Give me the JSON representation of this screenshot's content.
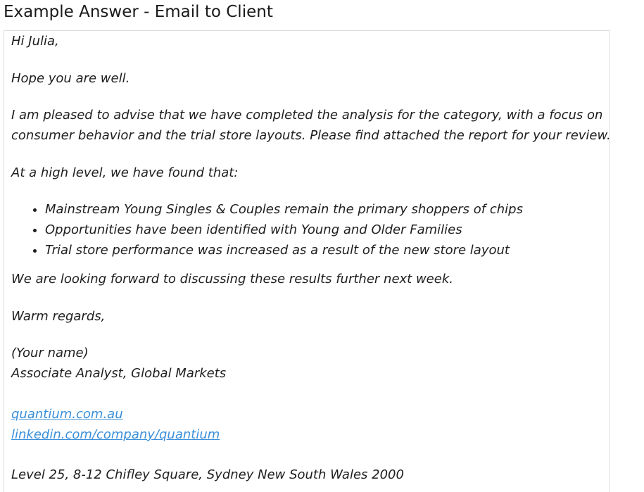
{
  "title": "Example Answer - Email to Client",
  "email": {
    "greeting": "Hi Julia,",
    "opener": "Hope you are well.",
    "body_line_1": "I am pleased to advise that we have completed the analysis for the category, with a focus on",
    "body_line_2": "consumer behavior and the trial store layouts. Please find attached the report for your review.",
    "findings_intro": "At a high level, we have found that:",
    "findings": [
      "Mainstream Young Singles & Couples remain the primary shoppers of chips",
      "Opportunities have been identified with Young and Older Families",
      "Trial store performance was increased as a result of the new store layout"
    ],
    "closing_line": "We are looking forward to discussing these results further next week.",
    "sign_off": "Warm regards,",
    "sender_name": "(Your name)",
    "sender_title": "Associate Analyst, Global Markets",
    "links": {
      "website": "quantium.com.au ",
      "linkedin": "linkedin.com/company/quantium "
    },
    "address": "Level 25, 8-12 Chifley Square, Sydney New South Wales 2000"
  },
  "colors": {
    "link": "#3a8fd9",
    "border": "#dcdcdc",
    "text": "#1e1e1e"
  }
}
